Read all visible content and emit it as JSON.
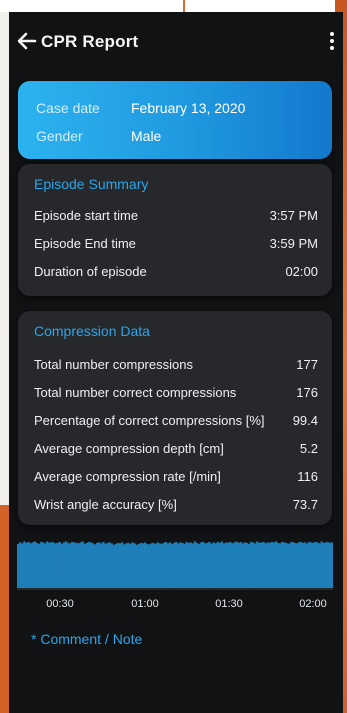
{
  "header": {
    "title": "CPR Report"
  },
  "case": {
    "date_label": "Case date",
    "date_value": "February 13, 2020",
    "gender_label": "Gender",
    "gender_value": "Male"
  },
  "episode": {
    "title": "Episode Summary",
    "rows": [
      {
        "label": "Episode start time",
        "value": "3:57 PM"
      },
      {
        "label": "Episode End time",
        "value": "3:59 PM"
      },
      {
        "label": "Duration of episode",
        "value": "02:00"
      }
    ]
  },
  "compression": {
    "title": "Compression Data",
    "rows": [
      {
        "label": "Total number compressions",
        "value": "177"
      },
      {
        "label": "Total number correct compressions",
        "value": "176"
      },
      {
        "label": "Percentage of correct compressions [%]",
        "value": "99.4"
      },
      {
        "label": "Average compression depth [cm]",
        "value": "5.2"
      },
      {
        "label": "Average compression rate [/min]",
        "value": "116"
      },
      {
        "label": "Wrist angle accuracy [%]",
        "value": "73.7"
      }
    ]
  },
  "chart_data": {
    "type": "bar",
    "x_ticks": [
      "00:30",
      "01:00",
      "01:30",
      "02:00"
    ],
    "bar_color": "#1f7fb8",
    "values": [
      0.92,
      0.95,
      0.93,
      0.97,
      0.94,
      0.96,
      0.93,
      0.95,
      0.97,
      0.94,
      0.92,
      0.96,
      0.95,
      0.93,
      0.97,
      0.94,
      0.96,
      0.95,
      0.93,
      0.94,
      0.96,
      0.92,
      0.95,
      0.97,
      0.94,
      0.93,
      0.96,
      0.95,
      0.94,
      0.93,
      0.95,
      0.97,
      0.92,
      0.94,
      0.96,
      0.95,
      0.93,
      0.91,
      0.94,
      0.95,
      0.93,
      0.96,
      0.92,
      0.94,
      0.95,
      0.93,
      0.9,
      0.92,
      0.94,
      0.93,
      0.95,
      0.91,
      0.93,
      0.94,
      0.92,
      0.95,
      0.93,
      0.9,
      0.92,
      0.94,
      0.93,
      0.95,
      0.92,
      0.91,
      0.93,
      0.94,
      0.92,
      0.95,
      0.93,
      0.92,
      0.94,
      0.96,
      0.93,
      0.95,
      0.92,
      0.94,
      0.96,
      0.93,
      0.95,
      0.94,
      0.92,
      0.96,
      0.94,
      0.95,
      0.93,
      0.97,
      0.94,
      0.92,
      0.95,
      0.96,
      0.93,
      0.94,
      0.96,
      0.92,
      0.95,
      0.93,
      0.96,
      0.94,
      0.97,
      0.93,
      0.95,
      0.94,
      0.96,
      0.93,
      0.95,
      0.97,
      0.94,
      0.96,
      0.93,
      0.95,
      0.94,
      0.92,
      0.96,
      0.95,
      0.93,
      0.97,
      0.94,
      0.95,
      0.96,
      0.93,
      0.95,
      0.94,
      0.96,
      0.95,
      0.97,
      0.94,
      0.93,
      0.96,
      0.95,
      0.94,
      0.92,
      0.95,
      0.96,
      0.94,
      0.93,
      0.95,
      0.96,
      0.94,
      0.95,
      0.93,
      0.96,
      0.95,
      0.94,
      0.96,
      0.95,
      0.93,
      0.97,
      0.94,
      0.95,
      0.96,
      0.94,
      0.95
    ]
  },
  "comment": {
    "label": "* Comment / Note"
  }
}
